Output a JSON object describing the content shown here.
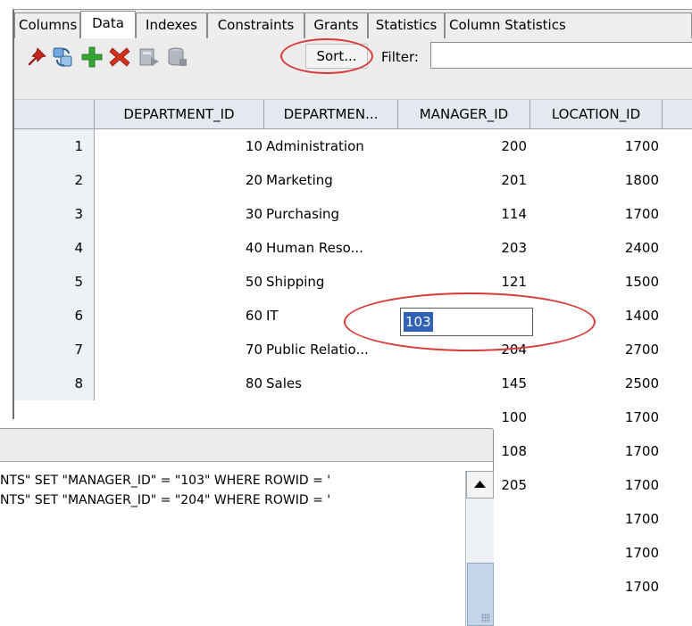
{
  "tabs": [
    "Columns",
    "Data",
    "Indexes",
    "Constraints",
    "Grants",
    "Statistics",
    "Column Statistics"
  ],
  "toolbar": {
    "icons": [
      "pin-icon",
      "refresh-icon",
      "insert-row-icon",
      "delete-row-icon",
      "commit-icon",
      "rollback-icon"
    ],
    "sort_label": "Sort...",
    "filter_label": "Filter:",
    "filter_value": ""
  },
  "grid": {
    "columns": [
      "DEPARTMENT_ID",
      "DEPARTMEN...",
      "MANAGER_ID",
      "LOCATION_ID"
    ],
    "rows": [
      {
        "num": "1",
        "dept_id": "10",
        "dept_name": "Administration",
        "manager_id": "200",
        "location_id": "1700"
      },
      {
        "num": "2",
        "dept_id": "20",
        "dept_name": "Marketing",
        "manager_id": "201",
        "location_id": "1800"
      },
      {
        "num": "3",
        "dept_id": "30",
        "dept_name": "Purchasing",
        "manager_id": "114",
        "location_id": "1700"
      },
      {
        "num": "4",
        "dept_id": "40",
        "dept_name": "Human Reso...",
        "manager_id": "203",
        "location_id": "2400"
      },
      {
        "num": "5",
        "dept_id": "50",
        "dept_name": "Shipping",
        "manager_id": "121",
        "location_id": "1500"
      },
      {
        "num": "6",
        "dept_id": "60",
        "dept_name": "IT",
        "manager_id": "",
        "location_id": "1400"
      },
      {
        "num": "7",
        "dept_id": "70",
        "dept_name": "Public Relatio...",
        "manager_id": "204",
        "location_id": "2700"
      },
      {
        "num": "8",
        "dept_id": "80",
        "dept_name": "Sales",
        "manager_id": "145",
        "location_id": "2500"
      },
      {
        "num": "",
        "dept_id": "",
        "dept_name": "",
        "manager_id": "100",
        "location_id": "1700"
      },
      {
        "num": "",
        "dept_id": "",
        "dept_name": "",
        "manager_id": "108",
        "location_id": "1700"
      },
      {
        "num": "",
        "dept_id": "",
        "dept_name": "",
        "manager_id": "205",
        "location_id": "1700"
      },
      {
        "num": "",
        "dept_id": "",
        "dept_name": "",
        "manager_id": "",
        "location_id": "1700"
      },
      {
        "num": "",
        "dept_id": "",
        "dept_name": "",
        "manager_id": "",
        "location_id": "1700"
      },
      {
        "num": "",
        "dept_id": "",
        "dept_name": "",
        "manager_id": "",
        "location_id": "1700"
      }
    ],
    "editing_value": "103"
  },
  "log": {
    "lines": [
      "NTS\" SET \"MANAGER_ID\" = \"103\" WHERE ROWID = '",
      "NTS\" SET \"MANAGER_ID\" = \"204\" WHERE ROWID = '"
    ]
  },
  "colors": {
    "highlight_ring": "#d93a3a",
    "selection": "#2f62b4",
    "header_bg": "#e3e9ef",
    "toolbar_bg": "#ececec"
  }
}
